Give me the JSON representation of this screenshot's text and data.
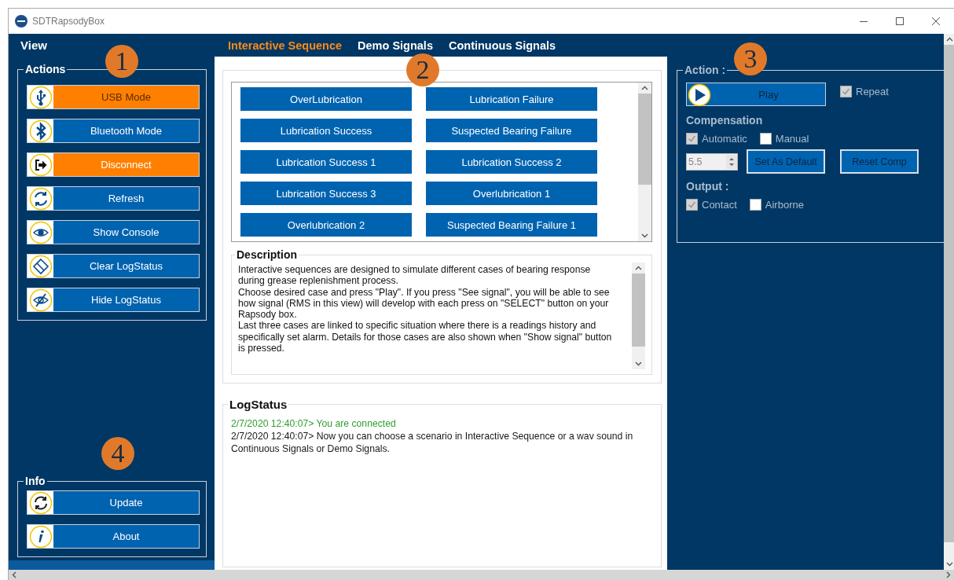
{
  "window": {
    "title": "SDTRapsodyBox"
  },
  "menu": {
    "label": "View"
  },
  "tabs": [
    {
      "label": "Interactive Sequence",
      "selected": true
    },
    {
      "label": "Demo Signals",
      "selected": false
    },
    {
      "label": "Continuous Signals",
      "selected": false
    }
  ],
  "actions": {
    "title": "Actions",
    "buttons": [
      {
        "label": "USB Mode",
        "highlighted": true
      },
      {
        "label": "Bluetooth Mode",
        "highlighted": false
      },
      {
        "label": "Disconnect",
        "highlighted": true
      },
      {
        "label": "Refresh",
        "highlighted": false
      },
      {
        "label": "Show Console",
        "highlighted": false
      },
      {
        "label": "Clear LogStatus",
        "highlighted": false
      },
      {
        "label": "Hide LogStatus",
        "highlighted": false
      }
    ]
  },
  "info": {
    "title": "Info",
    "buttons": [
      {
        "label": "Update",
        "highlighted": false
      },
      {
        "label": "About",
        "highlighted": false
      }
    ]
  },
  "signals": [
    "OverLubrication",
    "Lubrication Failure",
    "Lubrication Success",
    "Suspected Bearing Failure",
    "Lubrication Success 1",
    "Lubrication Success 2",
    "Lubrication Success 3",
    "Overlubrication 1",
    "Overlubrication 2",
    "Suspected Bearing Failure 1"
  ],
  "description": {
    "title": "Description",
    "paragraphs": [
      "Interactive sequences are designed to simulate different cases of bearing response during grease replenishment process.",
      "Choose desired case and press \"Play\". If you press \"See signal\", you will be able to see how signal (RMS in this view) will develop with each press on \"SELECT\" button on your Rapsody box.",
      "Last three cases are linked to specific situation where there is a readings history and specifically set alarm. Details for those cases are also shown when \"Show signal\" button is pressed."
    ]
  },
  "log": {
    "title": "LogStatus",
    "entries": [
      {
        "text": "2/7/2020 12:40:07> You are connected",
        "color": "#2e9e2e"
      },
      {
        "text": "2/7/2020 12:40:07> Now you can choose a scenario in Interactive Sequence or a wav sound in Continuous Signals or Demo Signals.",
        "color": "#1a1a1a"
      }
    ]
  },
  "action": {
    "title": "Action :",
    "play": "Play",
    "repeat": {
      "label": "Repeat",
      "checked": true
    },
    "compensation_title": "Compensation",
    "automatic": {
      "label": "Automatic",
      "checked": true
    },
    "manual": {
      "label": "Manual",
      "checked": false
    },
    "value": "5.5",
    "set_default": "Set As Default",
    "reset": "Reset Comp",
    "output_title": "Output :",
    "contact": {
      "label": "Contact",
      "checked": true
    },
    "airborne": {
      "label": "Airborne",
      "checked": false
    }
  },
  "callouts": [
    "1",
    "2",
    "3",
    "4"
  ]
}
